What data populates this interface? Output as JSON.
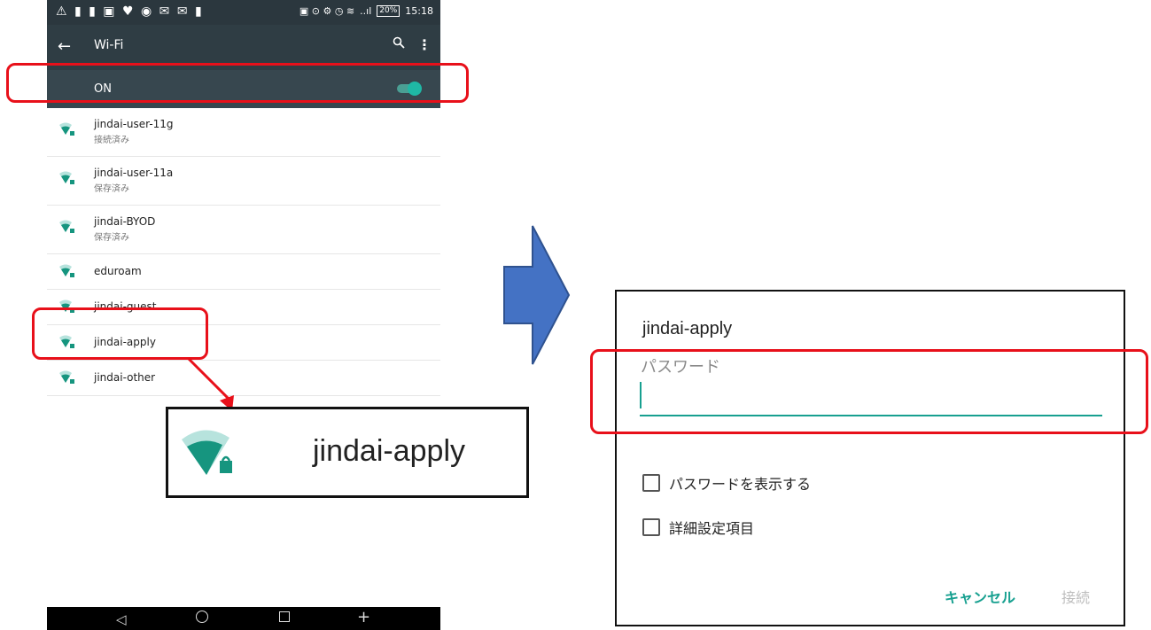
{
  "statusbar": {
    "left_icons": "⚠ ▮ ▮ ▣ ♥ ◉ ✉ ✉ ▮",
    "right_icons": "▣ ⊙ ⚙ ◷ ≋",
    "signal": "..ıl",
    "battery": "20%",
    "time": "15:18"
  },
  "appbar": {
    "title": "Wi-Fi"
  },
  "toggle_row": {
    "label": "ON",
    "state": true
  },
  "networks": [
    {
      "name": "jindai-user-11g",
      "status": "接続済み"
    },
    {
      "name": "jindai-user-11a",
      "status": "保存済み"
    },
    {
      "name": "jindai-BYOD",
      "status": "保存済み"
    },
    {
      "name": "eduroam",
      "status": ""
    },
    {
      "name": "jindai-guest",
      "status": ""
    },
    {
      "name": "jindai-apply",
      "status": ""
    },
    {
      "name": "jindai-other",
      "status": ""
    }
  ],
  "zoom": {
    "network_name": "jindai-apply"
  },
  "dialog": {
    "title": "jindai-apply",
    "password_label": "パスワード",
    "password_value": "",
    "show_password_label": "パスワードを表示する",
    "advanced_label": "詳細設定項目",
    "cancel_label": "キャンセル",
    "connect_label": "接続"
  },
  "colors": {
    "accent": "#17a090",
    "highlight": "#e8101a",
    "arrow_fill": "#4472c4",
    "appbar": "#2f3d44"
  }
}
